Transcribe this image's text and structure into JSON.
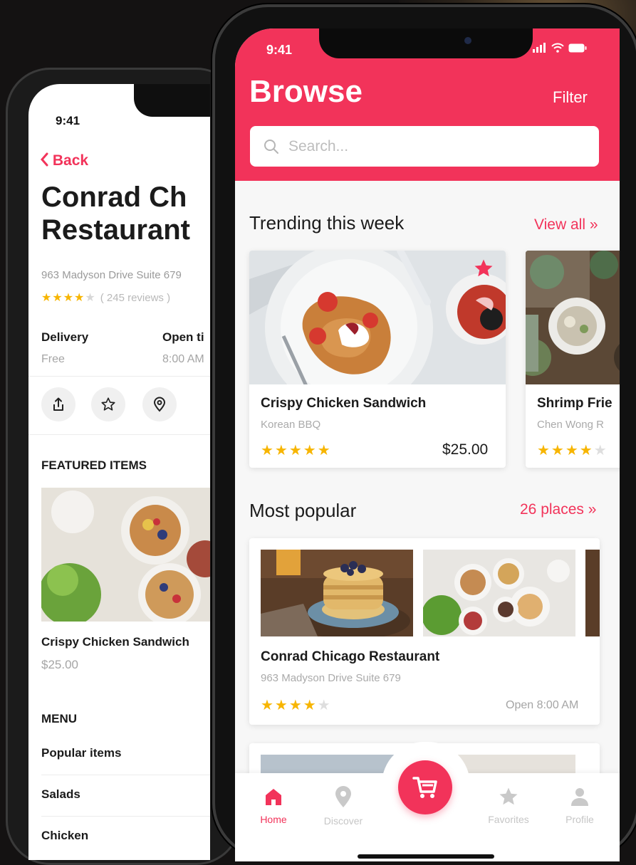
{
  "colors": {
    "accent": "#f2335a",
    "star": "#f7b500",
    "background": "#141212"
  },
  "detail_screen": {
    "status_time": "9:41",
    "back_label": "Back",
    "title_line1": "Conrad Ch",
    "title_line2": "Restaurant",
    "address": "963 Madyson Drive Suite 679",
    "rating_stars": 4,
    "reviews": "( 245 reviews )",
    "delivery_label": "Delivery",
    "delivery_value": "Free",
    "open_label": "Open ti",
    "open_value": "8:00 AM",
    "actions": [
      "share-icon",
      "star-icon",
      "location-pin-icon"
    ],
    "featured_heading": "FEATURED ITEMS",
    "featured_item": {
      "name": "Crispy Chicken Sandwich",
      "price": "$25.00"
    },
    "menu_heading": "MENU",
    "menu_items": [
      "Popular items",
      "Salads",
      "Chicken"
    ]
  },
  "browse_screen": {
    "status_time": "9:41",
    "title": "Browse",
    "filter_label": "Filter",
    "search_placeholder": "Search...",
    "trending": {
      "heading": "Trending this week",
      "link": "View all »",
      "cards": [
        {
          "name": "Crispy Chicken Sandwich",
          "subtitle": "Korean BBQ",
          "stars": 5,
          "price": "$25.00"
        },
        {
          "name": "Shrimp Frie",
          "subtitle": "Chen Wong R",
          "stars": 4
        }
      ]
    },
    "popular": {
      "heading": "Most popular",
      "link": "26 places »",
      "card": {
        "name": "Conrad Chicago Restaurant",
        "address": "963 Madyson Drive Suite 679",
        "stars": 4,
        "open": "Open 8:00 AM"
      }
    },
    "tabs": [
      {
        "label": "Home",
        "icon": "home-icon"
      },
      {
        "label": "Discover",
        "icon": "location-pin-icon"
      },
      {
        "label": "Favorites",
        "icon": "star-icon"
      },
      {
        "label": "Profile",
        "icon": "profile-icon"
      }
    ],
    "cart_icon": "cart-icon"
  }
}
